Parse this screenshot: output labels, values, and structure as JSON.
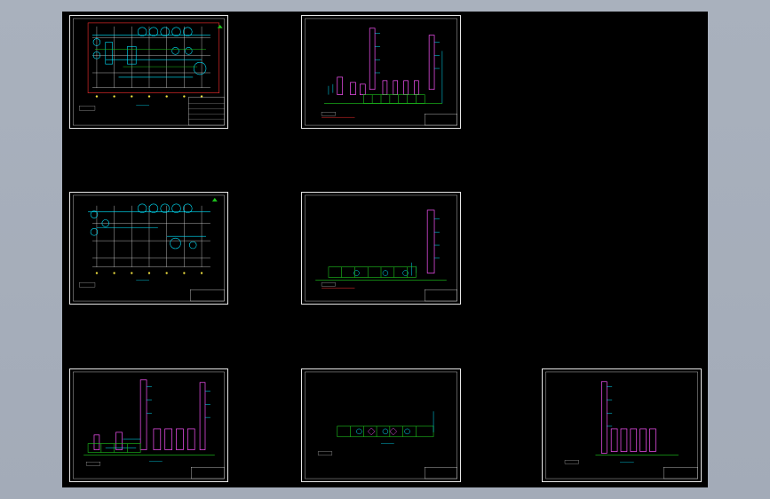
{
  "viewer": {
    "background": "#000000",
    "accent_cyan": "#00e5ff",
    "pipe_green": "#1ec81e",
    "vessel_magenta": "#ff55ff",
    "dim_yellow": "#f0e040",
    "border_red": "#ff3030"
  },
  "sheets": [
    {
      "id": "plan-1",
      "kind": "plan",
      "label": ""
    },
    {
      "id": "elevation-1",
      "kind": "elevation",
      "label": ""
    },
    {
      "id": "plan-2",
      "kind": "plan",
      "label": ""
    },
    {
      "id": "elevation-2",
      "kind": "elevation",
      "label": ""
    },
    {
      "id": "elevation-3",
      "kind": "elevation",
      "label": ""
    },
    {
      "id": "elevation-4",
      "kind": "elevation",
      "label": ""
    },
    {
      "id": "elevation-5",
      "kind": "elevation",
      "label": ""
    }
  ]
}
